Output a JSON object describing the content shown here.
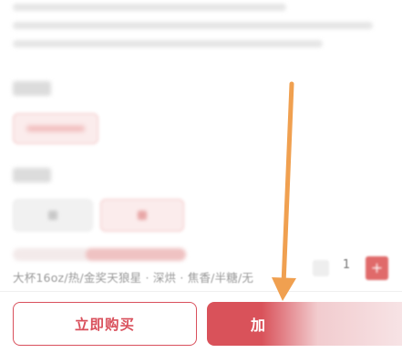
{
  "product": {
    "spec_summary": "大杯16oz/热/金奖天狼星 · 深烘 · 焦香/半糖/无",
    "quantity": "1"
  },
  "actions": {
    "buy_now_label": "立即购买",
    "add_to_cart_label": "加"
  },
  "icons": {
    "plus": "plus-icon",
    "minus": "minus-icon",
    "annotation": "orange-down-arrow"
  },
  "colors": {
    "brand_red": "#d9505c",
    "annotation_orange": "#f0a050"
  }
}
